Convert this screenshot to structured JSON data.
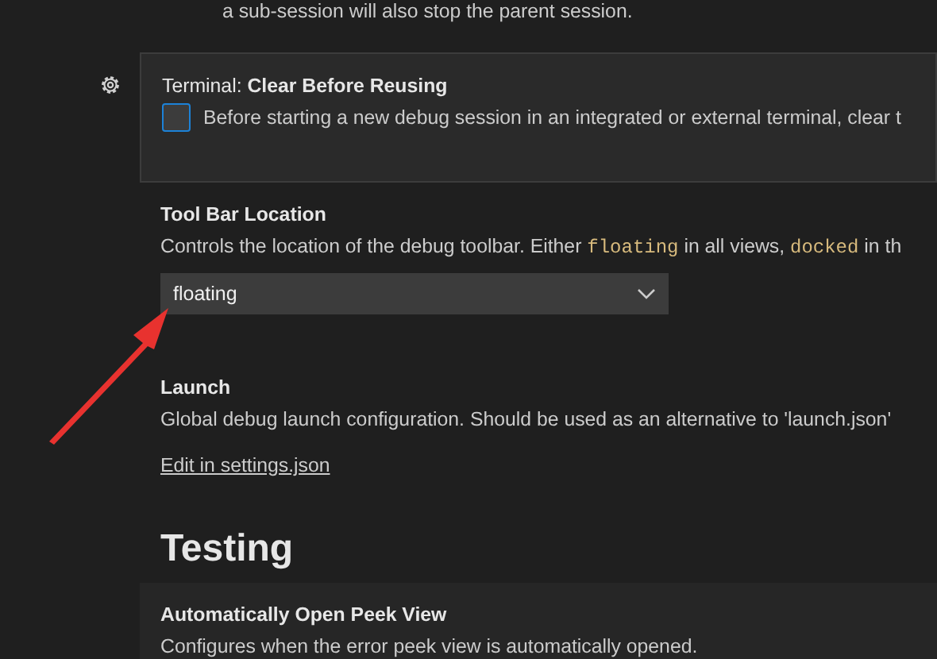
{
  "top_text": "a sub-session will also stop the parent session.",
  "settings": [
    {
      "kind": "checkbox",
      "focused": true,
      "category": "Terminal: ",
      "title": "Clear Before Reusing",
      "description": [
        {
          "text": "Before starting a new debug session in an integrated or external terminal, clear t",
          "code": false
        }
      ],
      "checked": false
    },
    {
      "kind": "dropdown",
      "focused": false,
      "title": "Tool Bar Location",
      "description": [
        {
          "text": "Controls the location of the debug toolbar. Either ",
          "code": false
        },
        {
          "text": "floating",
          "code": true
        },
        {
          "text": " in all views, ",
          "code": false
        },
        {
          "text": "docked",
          "code": true
        },
        {
          "text": " in th",
          "code": false
        }
      ],
      "value": "floating"
    },
    {
      "kind": "link",
      "focused": false,
      "title": "Launch",
      "description": [
        {
          "text": "Global debug launch configuration. Should be used as an alternative to 'launch.json'",
          "code": false
        }
      ],
      "link": "Edit in settings.json"
    }
  ],
  "section_heading": "Testing",
  "last_setting": {
    "title": "Automatically Open Peek View",
    "description": "Configures when the error peek view is automatically opened.",
    "hovered": true
  }
}
